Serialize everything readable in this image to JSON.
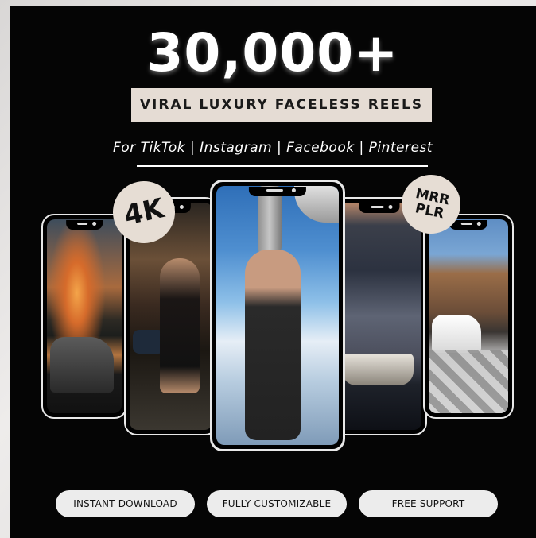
{
  "headline": "30,000+",
  "subtitle": "VIRAL LUXURY FACELESS REELS",
  "platforms": "For TikTok | Instagram | Facebook | Pinterest",
  "badges": {
    "quality": "4K",
    "license_line1": "MRR",
    "license_line2": "PLR"
  },
  "phones": [
    {
      "scene": "sunset-lake-boat"
    },
    {
      "scene": "woman-night-street"
    },
    {
      "scene": "skydiver-from-plane"
    },
    {
      "scene": "harbor-yacht-night"
    },
    {
      "scene": "villa-white-car"
    }
  ],
  "features": [
    "INSTANT DOWNLOAD",
    "FULLY CUSTOMIZABLE",
    "FREE SUPPORT"
  ],
  "colors": {
    "panel": "#050505",
    "accent_beige": "#e5dcd4",
    "pill": "#ececec",
    "text_light": "#ffffff"
  }
}
